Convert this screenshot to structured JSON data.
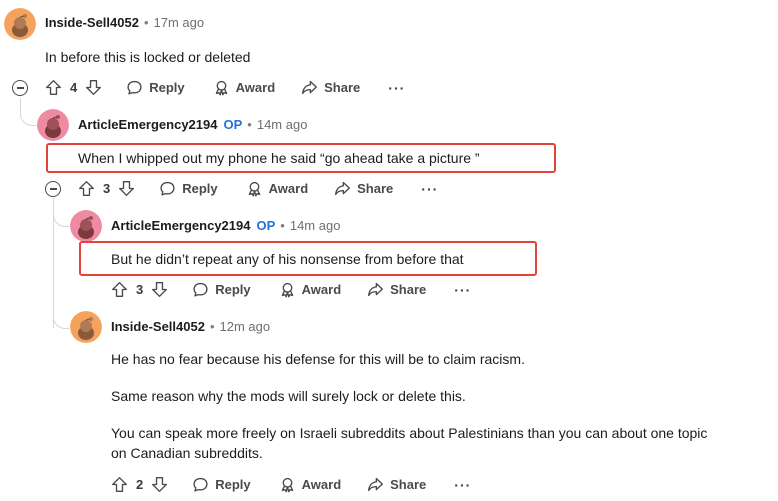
{
  "comments": [
    {
      "username": "Inside-Sell4052",
      "op_badge": "",
      "time": "17m ago",
      "body": [
        "In before this is locked or deleted"
      ],
      "votes": "4",
      "avatar_color": "#f5a35c"
    },
    {
      "username": "ArticleEmergency2194",
      "op_badge": "OP",
      "time": "14m ago",
      "body": [
        "When I whipped out my phone he said “go ahead take a picture ”"
      ],
      "votes": "3",
      "avatar_color": "#ef8aa3"
    },
    {
      "username": "ArticleEmergency2194",
      "op_badge": "OP",
      "time": "14m ago",
      "body": [
        "But he didn’t repeat any of his nonsense from before that"
      ],
      "votes": "3",
      "avatar_color": "#ef8aa3"
    },
    {
      "username": "Inside-Sell4052",
      "op_badge": "",
      "time": "12m ago",
      "body": [
        "He has no fear because his defense for this will be to claim racism.",
        "Same reason why the mods will surely lock or delete this.",
        "You can speak more freely on Israeli subreddits about Palestinians than you can about one topic",
        "on Canadian subreddits."
      ],
      "votes": "2",
      "avatar_color": "#f5a35c"
    }
  ],
  "actions": {
    "reply": "Reply",
    "award": "Award",
    "share": "Share",
    "more": "···"
  },
  "separator": "•",
  "colors": {
    "op": "#2a6fd6",
    "highlight": "#e0453a",
    "thread_line": "#d4d7da"
  },
  "icons": [
    "upvote-icon",
    "downvote-icon",
    "reply-icon",
    "award-icon",
    "share-icon",
    "collapse-icon",
    "snoo-avatar-icon"
  ]
}
